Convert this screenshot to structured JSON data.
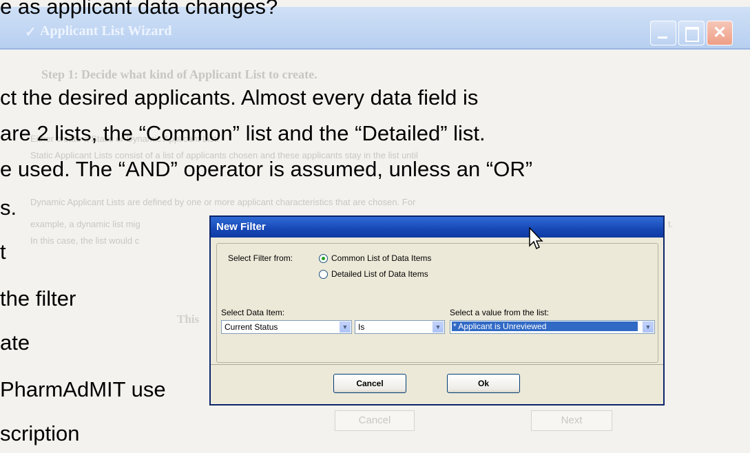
{
  "wizard": {
    "title": "Applicant List Wizard",
    "step_heading": "Step 1: Decide what kind of Applicant List to create.",
    "faint_line_1": "Either create a Static or Dynamic Applicant List.",
    "faint_line_2": "Static Applicant Lists consist of a list of applicants chosen and these applicants stay in the list until",
    "faint_line_3": "Dynamic Applicant Lists are defined by one or more applicant characteristics that are chosen.  For",
    "faint_line_4": "example, a dynamic list mig",
    "faint_line_4_end": "t.",
    "faint_line_5": "In this case, the list would c",
    "faint_bold": "This",
    "cancel_label": "Cancel",
    "next_label": "Next"
  },
  "slide": {
    "line_1": "e as applicant data changes?",
    "line_2": "ct the desired applicants. Almost every data field is",
    "line_3": "are 2 lists, the “Common” list and the “Detailed” list.",
    "line_4": "e used. The “AND” operator is assumed, unless an “OR”",
    "line_5": "s.",
    "line_6": "t",
    "line_7": "the filter",
    "line_8": "ate",
    "line_9": "PharmAdMIT use",
    "line_10": "scription"
  },
  "dialog": {
    "title": "New Filter",
    "filter_from_label": "Select Filter from:",
    "options": [
      "Common List of Data Items",
      "Detailed List of Data Items"
    ],
    "selected_option": "Common List of Data Items",
    "data_item_label": "Select Data Item:",
    "value_label": "Select a value from the list:",
    "data_item_value": "Current Status",
    "operator_value": "Is",
    "list_value": "* Applicant is Unreviewed",
    "cancel_label": "Cancel",
    "ok_label": "Ok"
  },
  "icons": {
    "cursor": "mouse-pointer-icon",
    "dropdown": "chevron-down-icon",
    "check": "check-icon"
  },
  "colors": {
    "dialog_title_bar": "#1747b5",
    "selection": "#316ac5",
    "radio_dot": "#21a121"
  }
}
